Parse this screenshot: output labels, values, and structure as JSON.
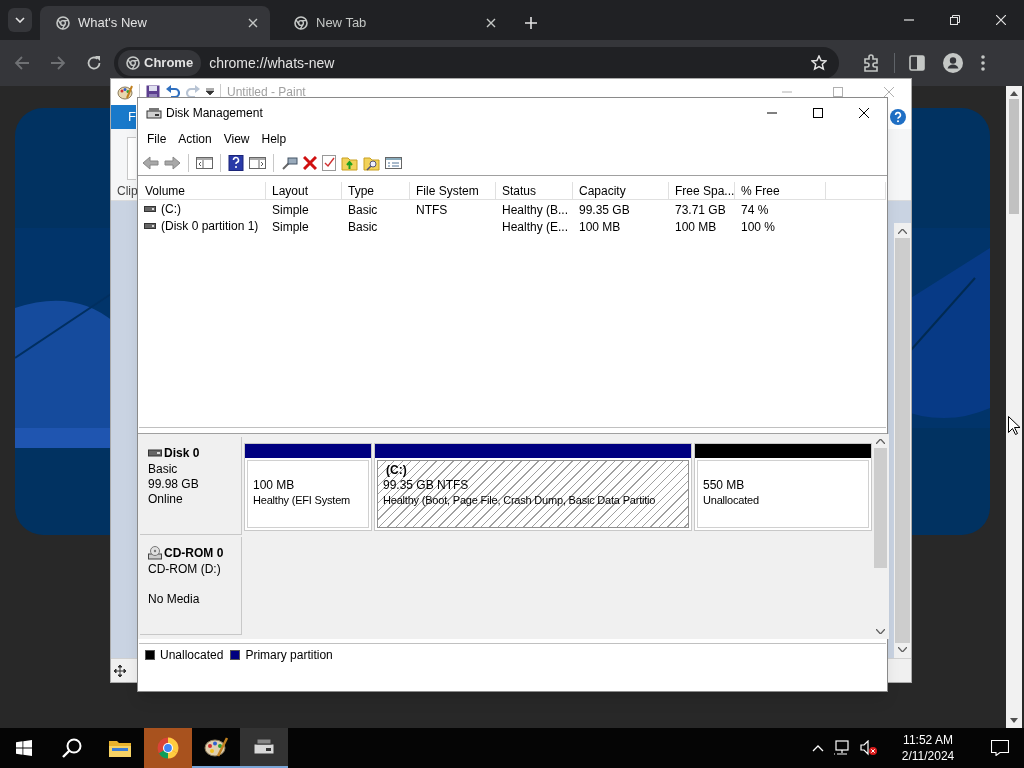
{
  "browser": {
    "tabs": [
      {
        "title": "What's New",
        "selected": true
      },
      {
        "title": "New Tab",
        "selected": false
      }
    ],
    "omnibox": {
      "chip": "Chrome",
      "url": "chrome://whats-new"
    }
  },
  "paint_window": {
    "title": "Untitled - Paint",
    "ribbon_tab": "F",
    "group_label": "Clip"
  },
  "disk_management": {
    "title": "Disk Management",
    "menu": [
      "File",
      "Action",
      "View",
      "Help"
    ],
    "columns": [
      "Volume",
      "Layout",
      "Type",
      "File System",
      "Status",
      "Capacity",
      "Free Spa...",
      "% Free"
    ],
    "rows": [
      {
        "volume": "(C:)",
        "layout": "Simple",
        "type": "Basic",
        "file_system": "NTFS",
        "status": "Healthy (B...",
        "capacity": "99.35 GB",
        "free_space": "73.71 GB",
        "percent_free": "74 %"
      },
      {
        "volume": "(Disk 0 partition 1)",
        "layout": "Simple",
        "type": "Basic",
        "status": "Healthy (E...",
        "capacity": "100 MB",
        "free_space": "100 MB",
        "percent_free": "100 %"
      }
    ],
    "disks": [
      {
        "kind": "disk",
        "name": "Disk 0",
        "type": "Basic",
        "size": "99.98 GB",
        "status": "Online",
        "partitions": [
          {
            "kind": "primary",
            "selected": false,
            "size": "100 MB",
            "status": "Healthy (EFI System"
          },
          {
            "kind": "primary",
            "selected": true,
            "label": "(C:)",
            "size": "99.35 GB NTFS",
            "status": "Healthy (Boot, Page File, Crash Dump, Basic Data Partitio"
          },
          {
            "kind": "unallocated",
            "selected": false,
            "size": "550 MB",
            "status": "Unallocated"
          }
        ]
      },
      {
        "kind": "cdrom",
        "name": "CD-ROM 0",
        "type": "CD-ROM (D:)",
        "status": "No Media"
      }
    ],
    "legend": [
      {
        "label": "Unallocated",
        "color": "#000000"
      },
      {
        "label": "Primary partition",
        "color": "#000080"
      }
    ]
  },
  "taskbar": {
    "time": "11:52 AM",
    "date": "2/11/2024"
  }
}
